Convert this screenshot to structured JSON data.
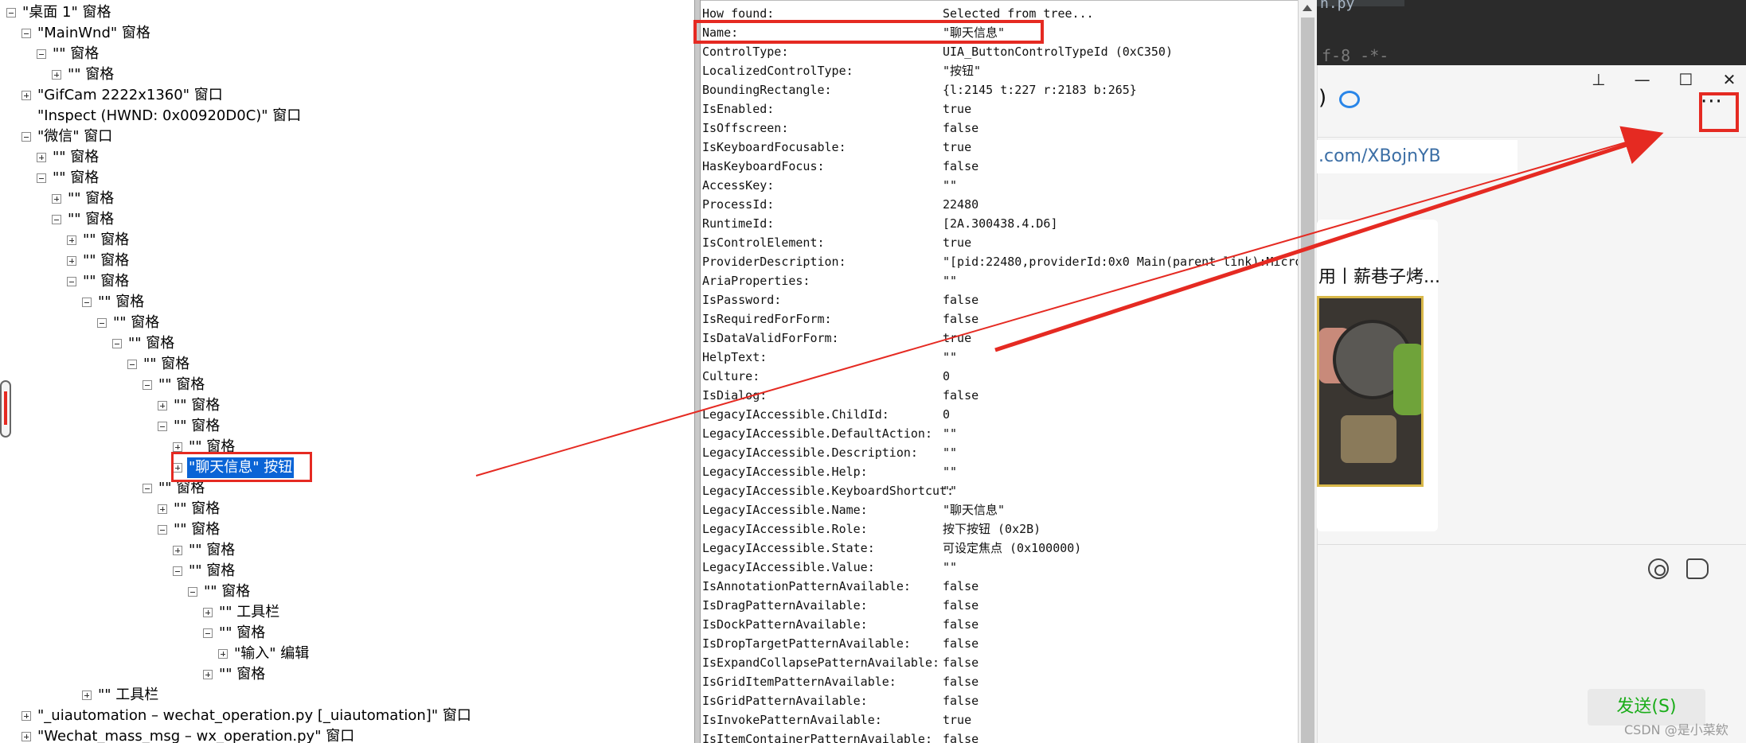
{
  "tree": {
    "rows": [
      {
        "label": "\"桌面 1\" 窗格",
        "toggle": "minus"
      },
      {
        "label": "\"MainWnd\" 窗格",
        "toggle": "minus"
      },
      {
        "label": "\"\" 窗格",
        "toggle": "minus"
      },
      {
        "label": "\"\" 窗格",
        "toggle": "plus"
      },
      {
        "label": "\"GifCam 2222x1360\" 窗口",
        "toggle": "plus"
      },
      {
        "label": "\"Inspect  (HWND: 0x00920D0C)\" 窗口",
        "toggle": "none"
      },
      {
        "label": "\"微信\" 窗口",
        "toggle": "minus"
      },
      {
        "label": "\"\" 窗格",
        "toggle": "plus"
      },
      {
        "label": "\"\" 窗格",
        "toggle": "minus"
      },
      {
        "label": "\"\" 窗格",
        "toggle": "plus"
      },
      {
        "label": "\"\" 窗格",
        "toggle": "minus"
      },
      {
        "label": "\"\" 窗格",
        "toggle": "plus"
      },
      {
        "label": "\"\" 窗格",
        "toggle": "plus"
      },
      {
        "label": "\"\" 窗格",
        "toggle": "minus"
      },
      {
        "label": "\"\" 窗格",
        "toggle": "minus"
      },
      {
        "label": "\"\" 窗格",
        "toggle": "minus"
      },
      {
        "label": "\"\" 窗格",
        "toggle": "minus"
      },
      {
        "label": "\"\" 窗格",
        "toggle": "minus"
      },
      {
        "label": "\"\" 窗格",
        "toggle": "minus"
      },
      {
        "label": "\"\" 窗格",
        "toggle": "plus"
      },
      {
        "label": "\"\" 窗格",
        "toggle": "minus"
      },
      {
        "label": "\"\" 窗格",
        "toggle": "plus"
      },
      {
        "label": "\"聊天信息\" 按钮",
        "toggle": "plus"
      },
      {
        "label": "\"\" 窗格",
        "toggle": "minus"
      },
      {
        "label": "\"\" 窗格",
        "toggle": "plus"
      },
      {
        "label": "\"\" 窗格",
        "toggle": "minus"
      },
      {
        "label": "\"\" 窗格",
        "toggle": "plus"
      },
      {
        "label": "\"\" 窗格",
        "toggle": "minus"
      },
      {
        "label": "\"\" 窗格",
        "toggle": "minus"
      },
      {
        "label": "\"\" 工具栏",
        "toggle": "plus"
      },
      {
        "label": "\"\" 窗格",
        "toggle": "minus"
      },
      {
        "label": "\"输入\" 编辑",
        "toggle": "plus"
      },
      {
        "label": "\"\" 窗格",
        "toggle": "plus"
      },
      {
        "label": "\"\" 工具栏",
        "toggle": "plus"
      },
      {
        "label": "\"_uiautomation – wechat_operation.py [_uiautomation]\" 窗口",
        "toggle": "plus"
      },
      {
        "label": "\"Wechat_mass_msg – wx_operation.py\" 窗口",
        "toggle": "plus"
      }
    ]
  },
  "properties": [
    {
      "key": "How found:",
      "value": "Selected from tree..."
    },
    {
      "key": "Name:",
      "value": "\"聊天信息\""
    },
    {
      "key": "ControlType:",
      "value": "UIA_ButtonControlTypeId (0xC350)"
    },
    {
      "key": "LocalizedControlType:",
      "value": "\"按钮\""
    },
    {
      "key": "BoundingRectangle:",
      "value": "{l:2145 t:227 r:2183 b:265}"
    },
    {
      "key": "IsEnabled:",
      "value": "true"
    },
    {
      "key": "IsOffscreen:",
      "value": "false"
    },
    {
      "key": "IsKeyboardFocusable:",
      "value": "true"
    },
    {
      "key": "HasKeyboardFocus:",
      "value": "false"
    },
    {
      "key": "AccessKey:",
      "value": "\"\""
    },
    {
      "key": "ProcessId:",
      "value": "22480"
    },
    {
      "key": "RuntimeId:",
      "value": "[2A.300438.4.D6]"
    },
    {
      "key": "IsControlElement:",
      "value": "true"
    },
    {
      "key": "ProviderDescription:",
      "value": "\"[pid:22480,providerId:0x0 Main(parent link):Micro"
    },
    {
      "key": "AriaProperties:",
      "value": "\"\""
    },
    {
      "key": "IsPassword:",
      "value": "false"
    },
    {
      "key": "IsRequiredForForm:",
      "value": "false"
    },
    {
      "key": "IsDataValidForForm:",
      "value": "true"
    },
    {
      "key": "HelpText:",
      "value": "\"\""
    },
    {
      "key": "Culture:",
      "value": "0"
    },
    {
      "key": "IsDialog:",
      "value": "false"
    },
    {
      "key": "LegacyIAccessible.ChildId:",
      "value": "0"
    },
    {
      "key": "LegacyIAccessible.DefaultAction:",
      "value": "\"\""
    },
    {
      "key": "LegacyIAccessible.Description:",
      "value": "\"\""
    },
    {
      "key": "LegacyIAccessible.Help:",
      "value": "\"\""
    },
    {
      "key": "LegacyIAccessible.KeyboardShortcut:",
      "value": "   \"\""
    },
    {
      "key": "LegacyIAccessible.Name:",
      "value": "\"聊天信息\""
    },
    {
      "key": "LegacyIAccessible.Role:",
      "value": "按下按钮 (0x2B)"
    },
    {
      "key": "LegacyIAccessible.State:",
      "value": "可设定焦点 (0x100000)"
    },
    {
      "key": "LegacyIAccessible.Value:",
      "value": "\"\""
    },
    {
      "key": "IsAnnotationPatternAvailable:",
      "value": "false"
    },
    {
      "key": "IsDragPatternAvailable:",
      "value": "false"
    },
    {
      "key": "IsDockPatternAvailable:",
      "value": "false"
    },
    {
      "key": "IsDropTargetPatternAvailable:",
      "value": "false"
    },
    {
      "key": "IsExpandCollapsePatternAvailable:",
      "value": "false"
    },
    {
      "key": "IsGridItemPatternAvailable:",
      "value": "false"
    },
    {
      "key": "IsGridPatternAvailable:",
      "value": "false"
    },
    {
      "key": "IsInvokePatternAvailable:",
      "value": "true"
    },
    {
      "key": "IsItemContainerPatternAvailable:",
      "value": "false"
    }
  ],
  "editor": {
    "tab_fragment": "n.py",
    "code_fragment": "f-8 -*-"
  },
  "chat": {
    "window_controls": {
      "pin": "⊥",
      "minimize": "—",
      "maximize": "☐",
      "close": "✕"
    },
    "title_fragment": ")",
    "more_label": "···",
    "link_text": ".com/XBojnYB",
    "card_title": "用丨薪巷子烤...",
    "send_label": "发送(S)",
    "watermark": "CSDN @是小菜欸"
  },
  "colors": {
    "highlight_red": "#e52a22",
    "selection_blue": "#0a64d6",
    "send_green": "#1aad19"
  }
}
